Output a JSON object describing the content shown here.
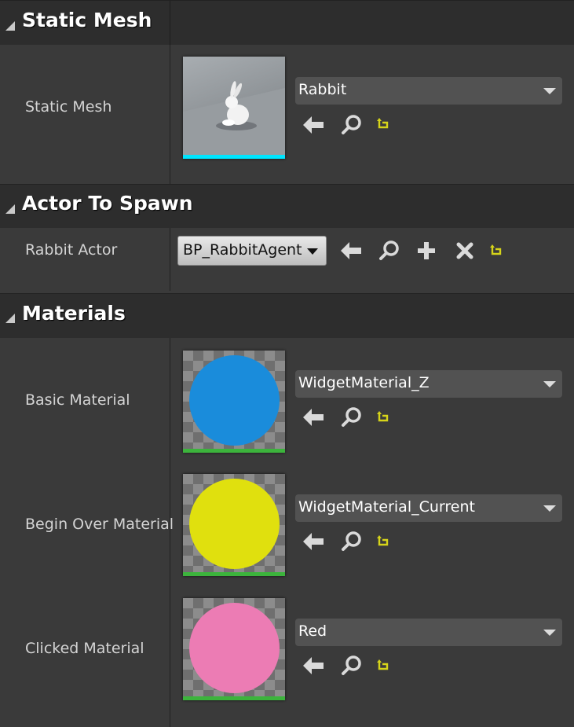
{
  "sections": {
    "static_mesh": {
      "title": "Static Mesh"
    },
    "actor_to_spawn": {
      "title": "Actor To Spawn"
    },
    "materials": {
      "title": "Materials"
    }
  },
  "static_mesh": {
    "label": "Static Mesh",
    "asset": "Rabbit",
    "thumbnail_bar_color": "#00e5ff"
  },
  "rabbit_actor": {
    "label": "Rabbit Actor",
    "value": "BP_RabbitAgent"
  },
  "materials": [
    {
      "label": "Basic Material",
      "asset": "WidgetMaterial_Z",
      "color": "#1a8cdb",
      "bar_color": "#3cb43c"
    },
    {
      "label": "Begin Over Material",
      "asset": "WidgetMaterial_Current",
      "color": "#e0e00e",
      "bar_color": "#3cb43c"
    },
    {
      "label": "Clicked Material",
      "asset": "Red",
      "color": "#ec7cb4",
      "bar_color": "#3cb43c"
    }
  ],
  "icons": {
    "use_selected": "arrow-left-icon",
    "browse": "search-icon",
    "reset": "reset-to-default-icon",
    "add": "plus-icon",
    "clear": "close-icon"
  },
  "colors": {
    "panel_bg": "#3a3a3a",
    "header_bg": "#2d2d2d",
    "reset_icon": "#d6d41a"
  }
}
